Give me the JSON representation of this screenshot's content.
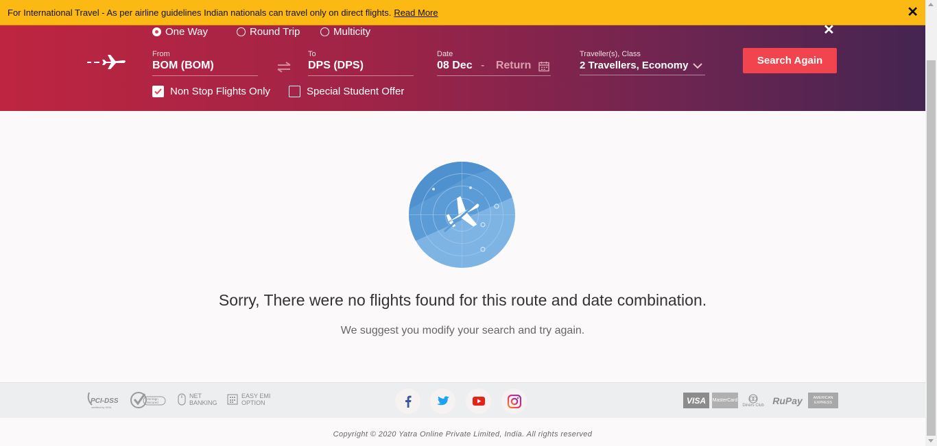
{
  "notice": {
    "text": "For International Travel - As per airline guidelines Indian nationals can travel only on direct flights.",
    "link": "Read More",
    "close": "✕"
  },
  "search": {
    "close": "✕",
    "trip_types": [
      {
        "label": "One Way",
        "selected": true
      },
      {
        "label": "Round Trip",
        "selected": false
      },
      {
        "label": "Multicity",
        "selected": false
      }
    ],
    "from_label": "From",
    "from_value": "BOM (BOM)",
    "to_label": "To",
    "to_value": "DPS (DPS)",
    "date_label": "Date",
    "date_value": "08 Dec",
    "date_sep": "-",
    "return_value": "Return",
    "travellers_label": "Traveller(s), Class",
    "travellers_value": "2 Travellers, Economy",
    "non_stop_label": "Non Stop Flights Only",
    "non_stop_checked": true,
    "student_label": "Special Student Offer",
    "student_checked": false,
    "search_button": "Search Again"
  },
  "results": {
    "title": "Sorry, There were no flights found for this route and date combination.",
    "subtitle": "We suggest you modify your search and try again."
  },
  "footer": {
    "badges": {
      "pci": "PCI-DSS",
      "verisign": "VeriSign Secured",
      "net_banking_1": "NET",
      "net_banking_2": "BANKING",
      "emi_1": "EASY EMI",
      "emi_2": "OPTION"
    },
    "payments": [
      "VISA",
      "MasterCard",
      "Diners Club",
      "RuPay",
      "AMERICAN EXPRESS"
    ],
    "copyright": "Copyright © 2020 Yatra Online Private Limited, India. All rights reserved"
  },
  "colors": {
    "notice_bg": "#fdb913",
    "hero_start": "#be2540",
    "hero_end": "#442551",
    "accent": "#f1444e"
  }
}
